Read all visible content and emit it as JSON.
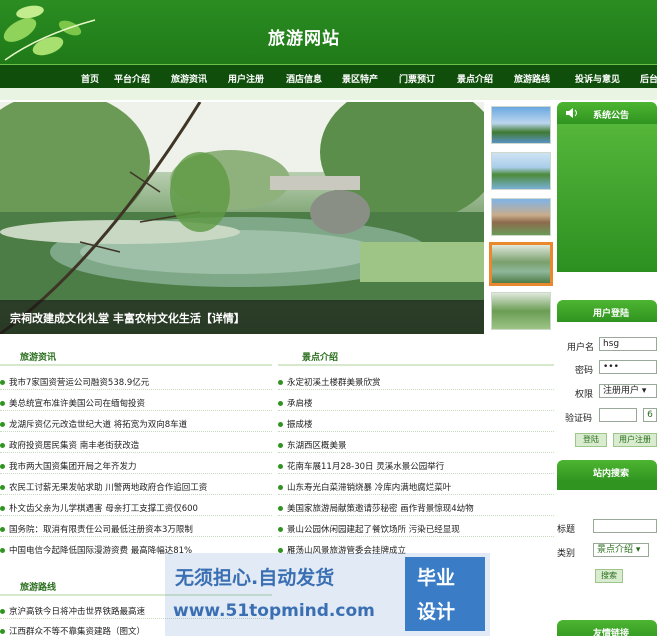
{
  "header": {
    "title": "旅游网站"
  },
  "nav": {
    "items": [
      "首页",
      "平台介绍",
      "旅游资讯",
      "用户注册",
      "酒店信息",
      "景区特产",
      "门票预订",
      "景点介绍",
      "旅游路线",
      "投诉与意见",
      "后台"
    ]
  },
  "hero": {
    "caption": "宗祠改建成文化礼堂 丰富农村文化生活【详情】"
  },
  "sidebar": {
    "notice_title": "系统公告",
    "login_title": "用户登陆",
    "username_label": "用户名",
    "username_value": "hsg",
    "password_label": "密码",
    "password_value": "•••",
    "role_label": "权限",
    "role_value": "注册用户 ▾",
    "captcha_label": "验证码",
    "captcha_image": "6",
    "login_button": "登陆",
    "register_button": "用户注册",
    "search_title": "站内搜索",
    "search_keyword_label": "标题",
    "search_category_label": "类别",
    "search_category_value": "景点介绍 ▾",
    "search_button": "搜索",
    "bottom_title": "友情链接"
  },
  "travel_news": {
    "title": "旅游资讯",
    "items": [
      "我市7家国资营运公司融资538.9亿元",
      "美总统宣布准许美国公司在缅甸投资",
      "龙湖斥资亿元改造世纪大道 将拓宽为双向8车道",
      "政府投资居民集资 南丰老街获改造",
      "我市两大国资集团开局之年齐发力",
      "农民工讨薪无果发帖求助 川警两地政府合作追回工资",
      "朴文齿父亲为儿学棋遇害 母亲打工支撑工资仅600",
      "国务院：取消有限责任公司最低注册资本3万限制",
      "中国电信今起降低国际漫游资费 最高降幅达81%"
    ]
  },
  "attractions": {
    "title": "景点介绍",
    "items": [
      "永定初溪土楼群美景欣赏",
      "承启楼",
      "振成楼",
      "东湖西区概美景",
      "花南车展11月28-30日 灵溪水景公园举行",
      "山东寿光白菜滞销烧暴 冷库内满地腐烂菜叶",
      "美国家旅游局献策邀请莎秘密 画作背景惊现4幼物",
      "景山公园休闲园建起了餐饮场所 污染已经显现",
      "雁荡山风景旅游管委会挂牌成立"
    ]
  },
  "travel_routes": {
    "title": "旅游路线",
    "items": [
      "京沪高铁今日将冲击世界铁路最高速",
      "江西群众不等不靠集资建路（图文）"
    ]
  },
  "watermark": {
    "line1": "无须担心.自动发货",
    "line2": "www.51topmind.com",
    "box1": "毕业",
    "box2": "设计"
  }
}
